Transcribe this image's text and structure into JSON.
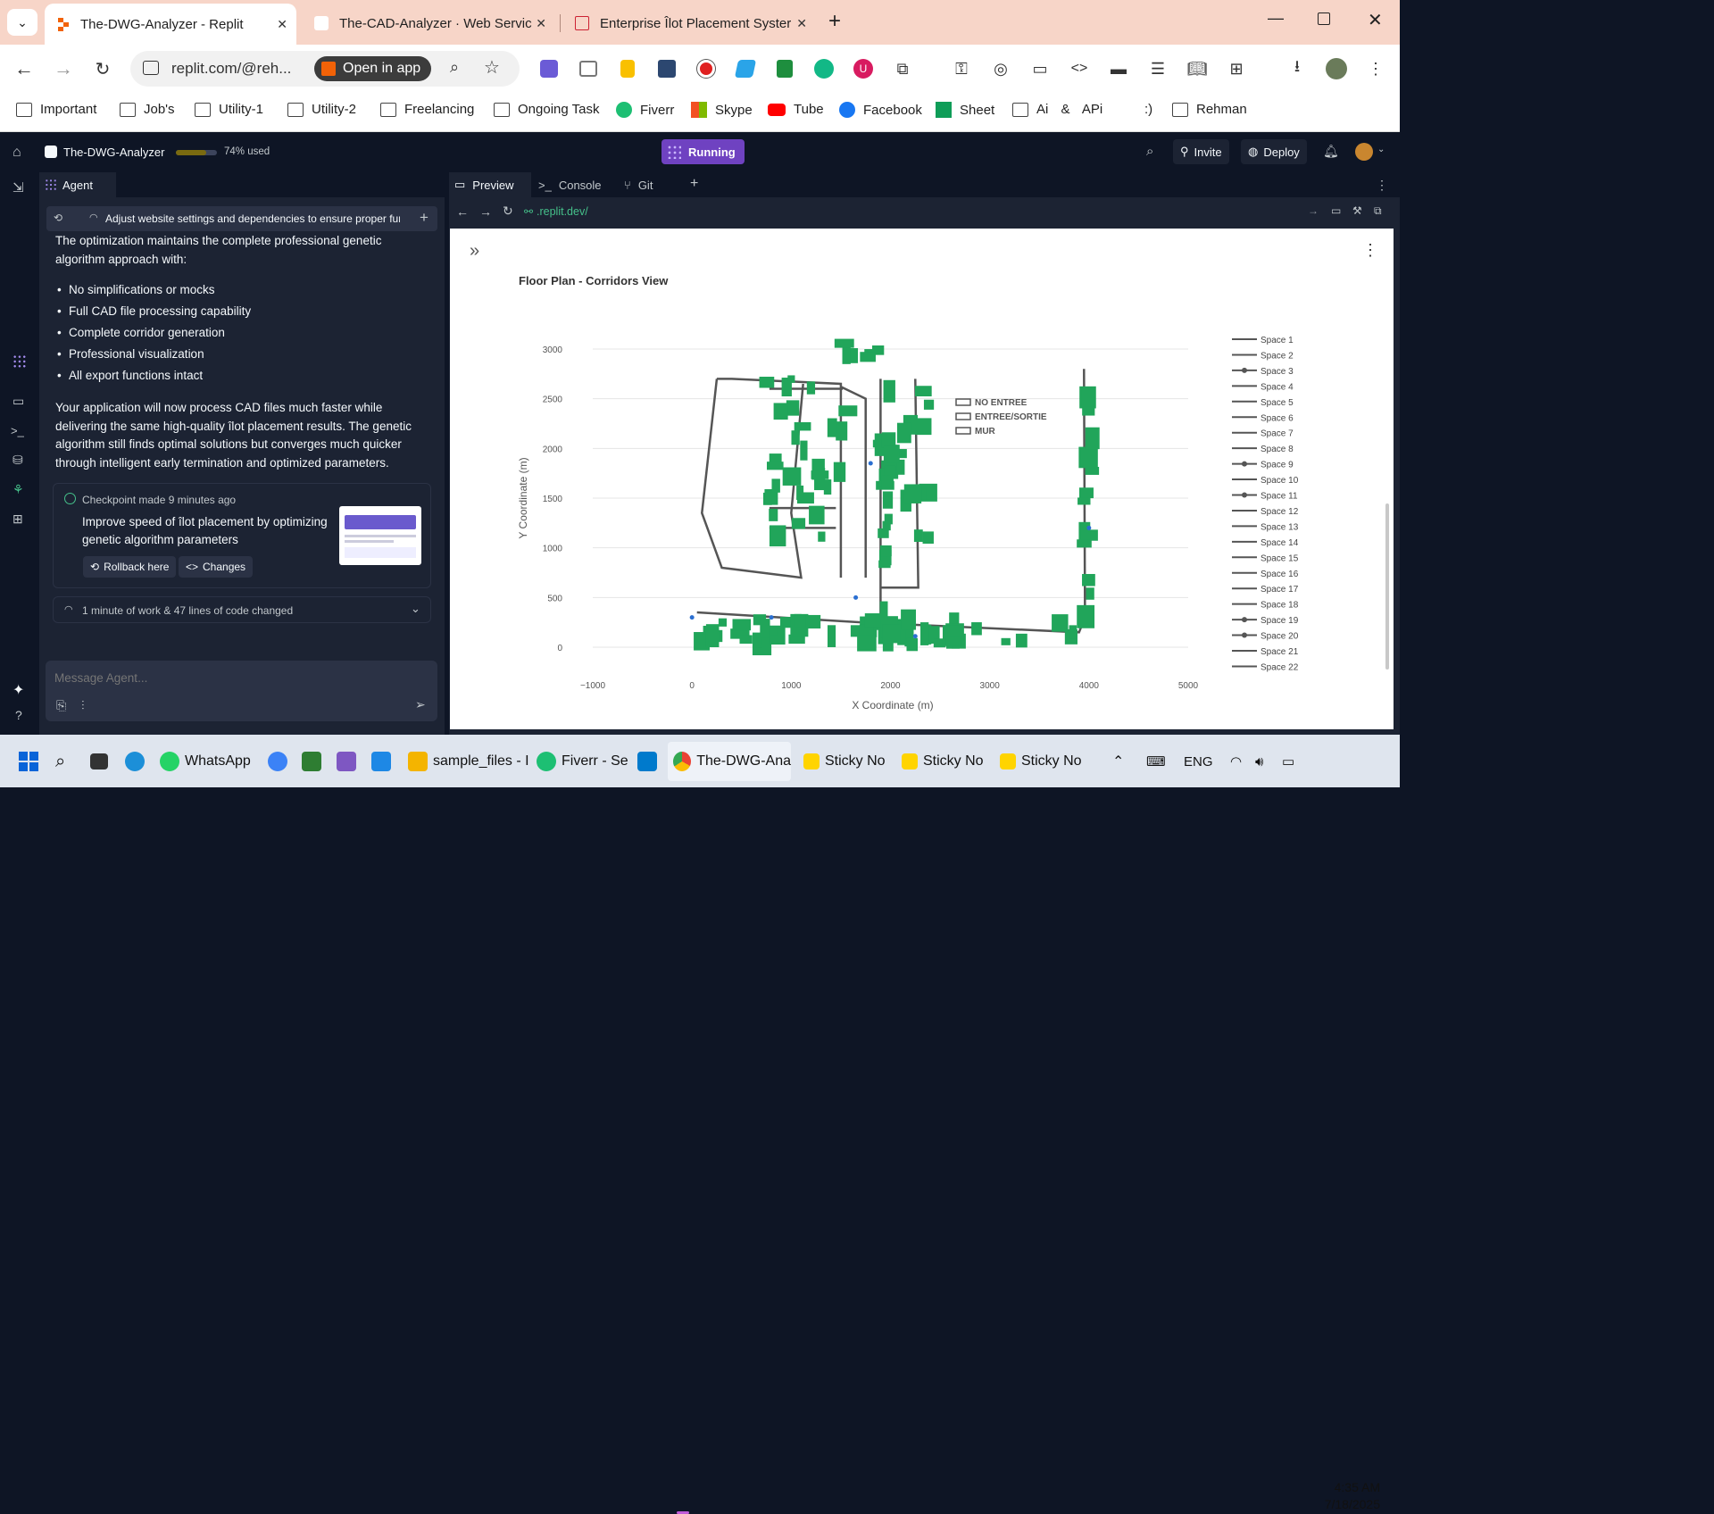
{
  "browser": {
    "tabs": [
      {
        "title": "The-DWG-Analyzer - Replit",
        "active": true
      },
      {
        "title": "The-CAD-Analyzer · Web Servic",
        "active": false
      },
      {
        "title": "Enterprise Îlot Placement Syster",
        "active": false
      }
    ],
    "address": "replit.com/@reh...",
    "open_in_app": "Open in app",
    "bookmarks": [
      "Important",
      "Job's",
      "Utility-1",
      "Utility-2",
      "Freelancing",
      "Ongoing Task",
      "Fiverr",
      "Skype",
      "Tube",
      "Facebook",
      "Sheet",
      "Ai & APi",
      ":)",
      "Rehman"
    ]
  },
  "replit": {
    "project": "The-DWG-Analyzer",
    "usage": "74% used",
    "usage_fraction": 0.74,
    "status": "Running",
    "invite": "Invite",
    "deploy": "Deploy"
  },
  "agent": {
    "tab": "Agent",
    "task": "Adjust website settings and dependencies to ensure proper fun...",
    "intro": "The optimization maintains the complete professional genetic algorithm approach with:",
    "bullets": [
      "No simplifications or mocks",
      "Full CAD file processing capability",
      "Complete corridor generation",
      "Professional visualization",
      "All export functions intact"
    ],
    "summary": "Your application will now process CAD files much faster while delivering the same high-quality îlot placement results. The genetic algorithm still finds optimal solutions but converges much quicker through intelligent early termination and optimized parameters.",
    "checkpoint_title": "Checkpoint made 9 minutes ago",
    "checkpoint_desc": "Improve speed of îlot placement by optimizing genetic algorithm parameters",
    "rollback": "Rollback here",
    "changes": "Changes",
    "work_summary": "1 minute of work & 47 lines of code changed",
    "message_placeholder": "Message Agent..."
  },
  "workspace": {
    "tabs": [
      "Preview",
      "Console",
      "Git"
    ],
    "url": ".replit.dev/"
  },
  "chart_data": {
    "type": "scatter",
    "title": "Floor Plan - Corridors View",
    "xlabel": "X Coordinate (m)",
    "ylabel": "Y Coordinate (m)",
    "xlim": [
      -1000,
      5000
    ],
    "ylim": [
      0,
      3000
    ],
    "x_ticks": [
      "−1000",
      "0",
      "1000",
      "2000",
      "3000",
      "4000",
      "5000"
    ],
    "y_ticks": [
      "3000",
      "2500",
      "2000",
      "1500",
      "1000",
      "500",
      "0"
    ],
    "legend_position": "right",
    "legend": [
      "Space 1",
      "Space 2",
      "Space 3",
      "Space 4",
      "Space 5",
      "Space 6",
      "Space 7",
      "Space 8",
      "Space 9",
      "Space 10",
      "Space 11",
      "Space 12",
      "Space 13",
      "Space 14",
      "Space 15",
      "Space 16",
      "Space 17",
      "Space 18",
      "Space 19",
      "Space 20",
      "Space 21",
      "Space 22"
    ],
    "legend_markers": [
      3,
      9,
      11,
      19,
      20
    ],
    "annotations": [
      "NO ENTREE",
      "ENTREE/SORTIE",
      "MUR"
    ],
    "ilots_color": "#21a55a",
    "wall_color": "#555555",
    "wall_segments": [
      [
        [
          250,
          2700
        ],
        [
          400,
          2700
        ],
        [
          1500,
          2650
        ],
        [
          1500,
          700
        ]
      ],
      [
        [
          250,
          2700
        ],
        [
          100,
          1350
        ],
        [
          300,
          800
        ],
        [
          1100,
          700
        ],
        [
          1000,
          1350
        ],
        [
          1120,
          2650
        ]
      ],
      [
        [
          780,
          2600
        ],
        [
          1520,
          2600
        ]
      ],
      [
        [
          780,
          1400
        ],
        [
          1450,
          1400
        ]
      ],
      [
        [
          780,
          1200
        ],
        [
          1450,
          1200
        ]
      ],
      [
        [
          1500,
          2620
        ],
        [
          1750,
          2500
        ],
        [
          1750,
          700
        ]
      ],
      [
        [
          3950,
          2800
        ],
        [
          3960,
          300
        ],
        [
          3900,
          150
        ],
        [
          1700,
          250
        ]
      ],
      [
        [
          50,
          350
        ],
        [
          1700,
          250
        ]
      ],
      [
        [
          1900,
          2700
        ],
        [
          1900,
          300
        ]
      ],
      [
        [
          2250,
          2700
        ],
        [
          2280,
          600
        ],
        [
          1900,
          600
        ]
      ]
    ],
    "ilot_clusters": [
      {
        "x": [
          0,
          4000
        ],
        "y": [
          20,
          280
        ],
        "count": 55
      },
      {
        "x": [
          1900,
          2000
        ],
        "y": [
          300,
          2700
        ],
        "count": 18
      },
      {
        "x": [
          3950,
          4050
        ],
        "y": [
          300,
          2700
        ],
        "count": 14
      },
      {
        "x": [
          750,
          1600
        ],
        "y": [
          1100,
          2700
        ],
        "count": 30
      },
      {
        "x": [
          2000,
          2400
        ],
        "y": [
          1100,
          2600
        ],
        "count": 14
      },
      {
        "x": [
          1500,
          2300
        ],
        "y": [
          2900,
          3100
        ],
        "count": 6
      }
    ],
    "blue_points": [
      [
        0,
        300
      ],
      [
        800,
        300
      ],
      [
        1650,
        500
      ],
      [
        2250,
        110
      ],
      [
        4000,
        1200
      ],
      [
        1800,
        1850
      ]
    ]
  }
}
